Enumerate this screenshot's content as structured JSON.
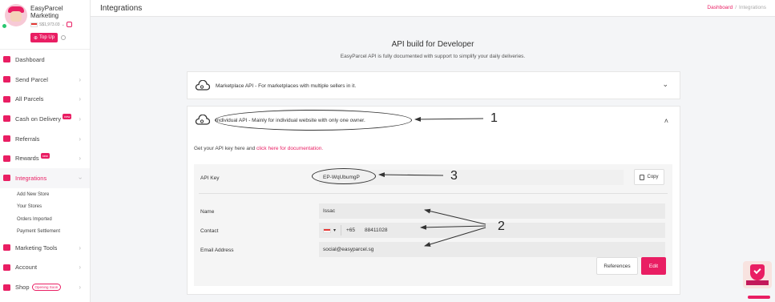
{
  "brand": {
    "name": "EasyParcel Marketing",
    "balance": "S$1,973.03",
    "topup_label": "Top Up"
  },
  "topbar": {
    "title": "Integrations",
    "breadcrumb": [
      "Dashboard",
      "Integrations"
    ]
  },
  "sidebar": {
    "items": [
      {
        "label": "Dashboard",
        "icon": "dashboard-icon"
      },
      {
        "label": "Send Parcel",
        "icon": "truck-icon"
      },
      {
        "label": "All Parcels",
        "icon": "parcels-icon"
      },
      {
        "label": "Cash on Delivery",
        "icon": "cash-icon",
        "badge": "new"
      },
      {
        "label": "Referrals",
        "icon": "referral-icon"
      },
      {
        "label": "Rewards",
        "icon": "gift-icon",
        "badge": "new"
      },
      {
        "label": "Integrations",
        "icon": "link-icon"
      }
    ],
    "sub_items": [
      "Add New Store",
      "Your Stores",
      "Orders Imported",
      "Payment Settlement"
    ],
    "bottom_items": [
      {
        "label": "Marketing Tools",
        "icon": "megaphone-icon"
      },
      {
        "label": "Account",
        "icon": "user-icon"
      },
      {
        "label": "Shop",
        "icon": "shop-icon",
        "badge": "Opening Soon"
      }
    ]
  },
  "main": {
    "title": "API build for Developer",
    "subtitle": "EasyParcel API is fully documented with support to simplify your daily deliveries.",
    "marketplace_api": "Marketplace API - For marketplaces with multiple sellers in it.",
    "individual_api": "Individual API - Mainly for individual website with only one owner.",
    "doc_prefix": "Get your API key here and ",
    "doc_link": "click here for documentation.",
    "api_key_label": "API Key",
    "api_key_value": "EP-WqUbumgP",
    "copy_label": "Copy",
    "name_label": "Name",
    "name_value": "Issac",
    "contact_label": "Contact",
    "contact_code": "+65",
    "contact_number": "88411028",
    "email_label": "Email Address",
    "email_value": "social@easyparcel.sg",
    "references_label": "References",
    "edit_label": "Edit"
  },
  "annotations": {
    "one": "1",
    "two": "2",
    "three": "3"
  },
  "colors": {
    "accent": "#e91e63"
  }
}
